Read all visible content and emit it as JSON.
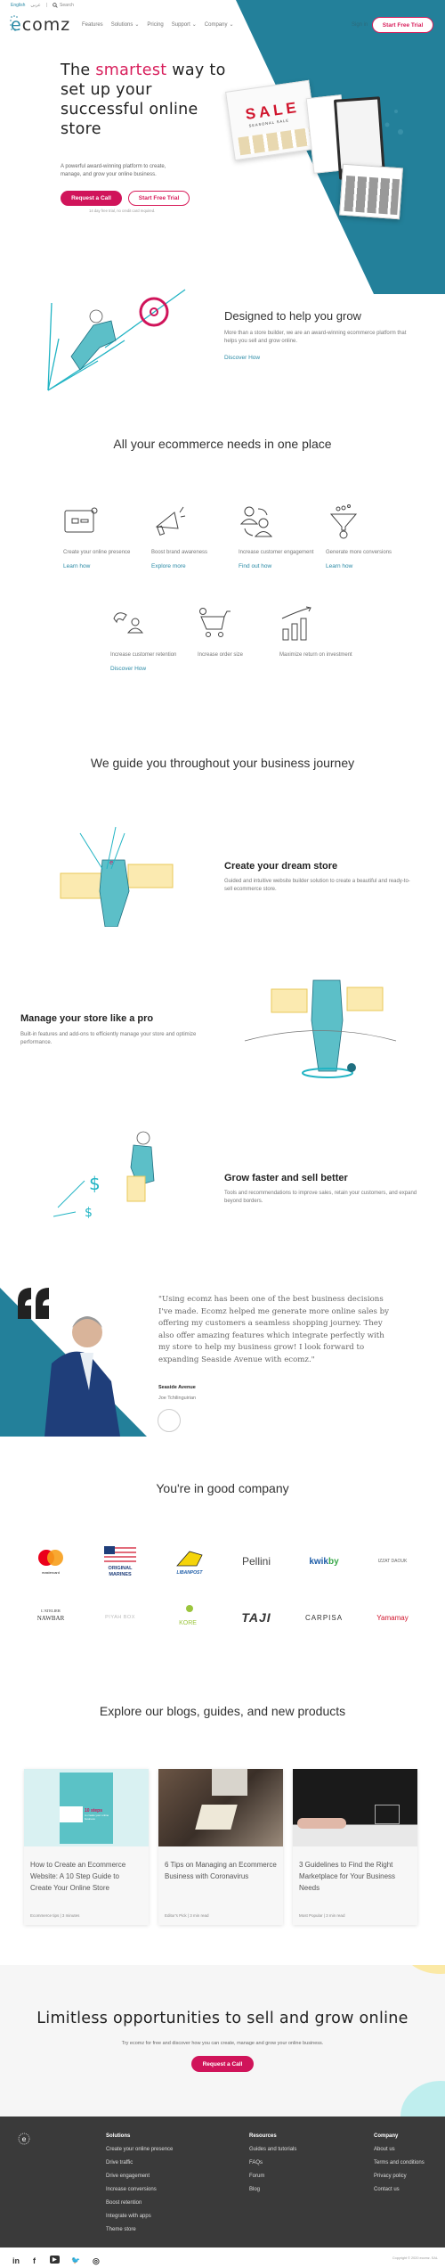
{
  "topbar": {
    "language": "English",
    "arabic_label": "عربي",
    "search_label": "Search"
  },
  "brand": {
    "name_prefix": "e",
    "name_rest": "comz",
    "accent_color": "#d81e5b",
    "teal_color": "#23809a"
  },
  "nav": {
    "items": [
      {
        "label": "Features",
        "has_dropdown": false
      },
      {
        "label": "Solutions",
        "has_dropdown": true
      },
      {
        "label": "Pricing",
        "has_dropdown": false
      },
      {
        "label": "Support",
        "has_dropdown": true
      },
      {
        "label": "Company",
        "has_dropdown": true
      }
    ],
    "signin": "Sign in",
    "start_trial": "Start Free Trial"
  },
  "hero": {
    "title_pre": "The ",
    "title_accent": "smartest",
    "title_rest": "way to set up your successful online store",
    "subtitle": "A powerful award-winning platform to create, manage, and grow your online business.",
    "request_call": "Request a Call",
    "start_trial": "Start Free Trial",
    "note": "14 day free trial, no credit card required.",
    "mockup_sale_text": "SALE",
    "mockup_sale_sub": "SEASONAL SALE"
  },
  "designed": {
    "title": "Designed to help you grow",
    "text": "More than a store builder, we are an award-winning ecommerce platform that helps you sell and grow online.",
    "link": "Discover How"
  },
  "needs": {
    "title": "All your ecommerce needs in one place",
    "features": [
      {
        "icon": "browser-window-icon",
        "label": "Create your online presence",
        "link": "Learn how"
      },
      {
        "icon": "megaphone-icon",
        "label": "Boost brand awareness",
        "link": "Explore more"
      },
      {
        "icon": "users-exchange-icon",
        "label": "Increase customer engagement",
        "link": "Find out how"
      },
      {
        "icon": "funnel-icon",
        "label": "Generate more conversions",
        "link": "Learn how"
      },
      {
        "icon": "magnet-user-icon",
        "label": "Increase customer retention",
        "link": "Discover How"
      },
      {
        "icon": "shopping-cart-icon",
        "label": "Increase order size",
        "link": ""
      },
      {
        "icon": "growth-chart-icon",
        "label": "Maximize return on investment",
        "link": ""
      }
    ]
  },
  "journey": {
    "title": "We guide you throughout your business journey",
    "steps": [
      {
        "title": "Create your dream store",
        "text": "Guided and intuitive website builder solution to create a beautiful and ready-to-sell ecommerce store."
      },
      {
        "title": "Manage your store like a pro",
        "text": "Built-in features and add-ons to efficiently manage your store and optimize performance."
      },
      {
        "title": "Grow faster and sell better",
        "text": "Tools and recommendations to improve sales, retain your customers, and expand beyond borders."
      }
    ]
  },
  "testimonial": {
    "quote": "\"Using ecomz has been one of the best business decisions I've made. Ecomz helped me generate more online sales by offering my customers a seamless shopping journey. They also offer amazing features which integrate perfectly with my store to help my business grow! I look forward to expanding Seaside Avenue with ecomz.\"",
    "company": "Seaside Avenue",
    "person": "Joe Tchilinguirian"
  },
  "company": {
    "title": "You're in good company",
    "logos": [
      "mastercard",
      "ORIGINAL MARINES",
      "LIBANPOST",
      "Pellini",
      "kwikby",
      "IZZAT DAOUK",
      "L'ATELIER NAWBAR",
      "PIYAH BOX",
      "KORE",
      "TAJI",
      "CARPISA",
      "Yamamay"
    ]
  },
  "blogs": {
    "title": "Explore our blogs, guides, and new products",
    "cards": [
      {
        "title": "How to Create an Ecommerce Website: A 10 Step Guide to Create Your Online Store",
        "meta": "Ecommerce tips  |  3 minutes",
        "thumb_text": "10 steps",
        "thumb_sub": "to create your online business"
      },
      {
        "title": "6 Tips on Managing an Ecommerce Business with Coronavirus",
        "meta": "Editor's Pick  |  3 min read"
      },
      {
        "title": "3 Guidelines to Find the Right Marketplace for Your Business Needs",
        "meta": "Most Popular  |  3 min read"
      }
    ]
  },
  "cta": {
    "title": "Limitless opportunities to sell and grow online",
    "subtitle": "Try ecomz for free and discover how you can create, manage and grow your online business.",
    "button": "Request a Call"
  },
  "footer": {
    "columns": [
      {
        "heading": "Solutions",
        "items": [
          "Create your online presence",
          "Drive traffic",
          "Drive engagement",
          "Increase conversions",
          "Boost retention",
          "Integrate with apps",
          "Theme store"
        ]
      },
      {
        "heading": "Resources",
        "items": [
          "Guides and tutorials",
          "FAQs",
          "Forum",
          "Blog"
        ]
      },
      {
        "heading": "Company",
        "items": [
          "About us",
          "Terms and conditions",
          "Privacy policy",
          "Contact us"
        ]
      }
    ],
    "social": [
      "in",
      "f",
      "▶",
      "🐦",
      "◎"
    ],
    "copyright": "Copyright © 2020 ecomz. SAL"
  }
}
